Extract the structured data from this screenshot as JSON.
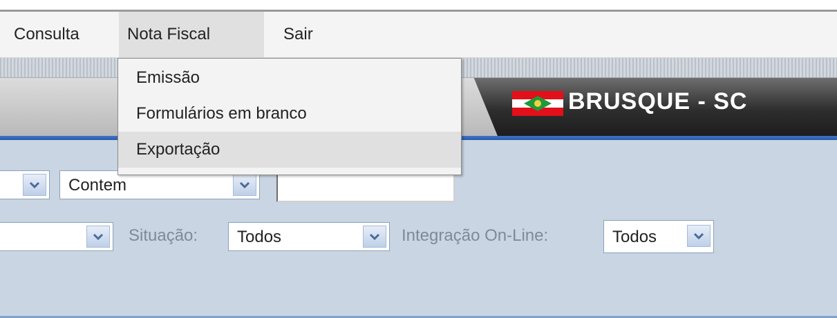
{
  "menubar": {
    "items": [
      {
        "label": "Consulta"
      },
      {
        "label": "Nota Fiscal"
      },
      {
        "label": "Sair"
      }
    ]
  },
  "dropdown": {
    "items": [
      {
        "label": "Emissão"
      },
      {
        "label": "Formulários em branco"
      },
      {
        "label": "Exportação"
      }
    ]
  },
  "header": {
    "city": "BRUSQUE - SC",
    "flag_icon": "santa-catarina-flag-icon",
    "colors": {
      "badge": "#2e2e2e",
      "accent_line": "#2a5aa8",
      "panel": "#c9d5e2"
    }
  },
  "filters": {
    "row1": {
      "select_1_value": "",
      "condition_value": "Contem",
      "text_value": ""
    },
    "row2": {
      "select_value": "",
      "situacao_label": "Situação:",
      "situacao_value": "Todos",
      "integracao_label": "Integração On-Line:",
      "integracao_value": "Todos"
    }
  }
}
